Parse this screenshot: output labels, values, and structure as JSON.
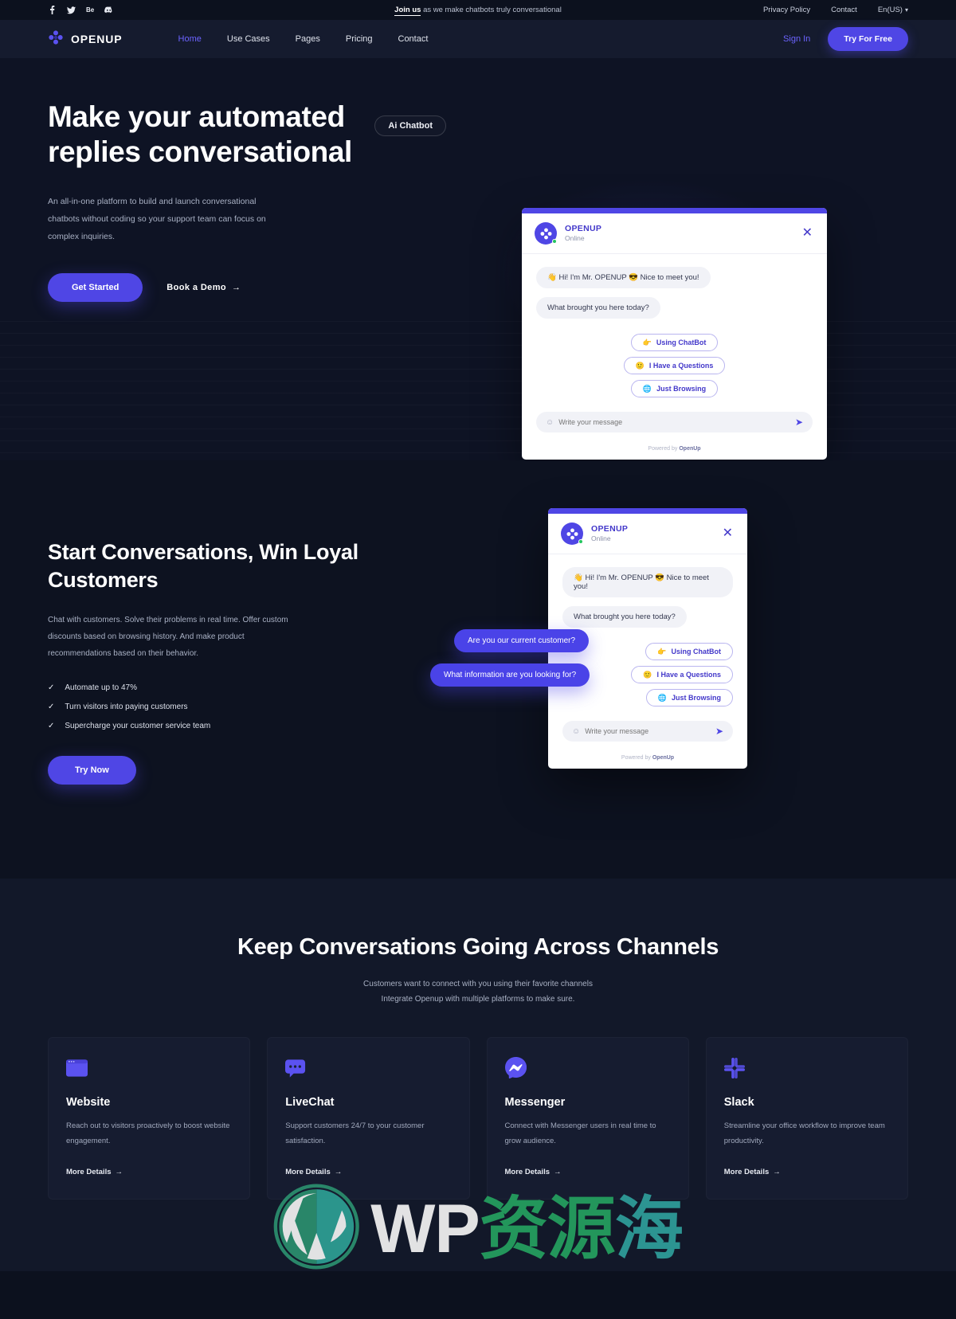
{
  "topbar": {
    "social": [
      {
        "name": "facebook-icon",
        "label": "f"
      },
      {
        "name": "twitter-icon",
        "label": "t"
      },
      {
        "name": "behance-icon",
        "label": "Be"
      },
      {
        "name": "discord-icon",
        "label": "d"
      }
    ],
    "announcement_link": "Join us",
    "announcement_rest": " as we make chatbots truly conversational",
    "privacy": "Privacy Policy",
    "contact": "Contact",
    "language": "En(US)"
  },
  "nav": {
    "brand": "OPENUP",
    "links": [
      {
        "label": "Home",
        "active": true
      },
      {
        "label": "Use Cases",
        "active": false
      },
      {
        "label": "Pages",
        "active": false
      },
      {
        "label": "Pricing",
        "active": false
      },
      {
        "label": "Contact",
        "active": false
      }
    ],
    "signin": "Sign In",
    "cta": "Try For Free"
  },
  "hero": {
    "title": "Make your automated replies conversational",
    "badge": "Ai Chatbot",
    "description": "An all-in-one platform to build and launch conversational chatbots without coding so your support team can focus on complex inquiries.",
    "primary_cta": "Get Started",
    "secondary_cta": "Book a  Demo",
    "secondary_arrow": "→"
  },
  "chat": {
    "name": "OPENUP",
    "status": "Online",
    "close": "✕",
    "messages": [
      "👋 Hi! I'm Mr. OPENUP 😎 Nice to meet you!",
      "What brought you here today?"
    ],
    "quick_replies": [
      {
        "icon": "👉",
        "label": "Using ChatBot"
      },
      {
        "icon": "🙂",
        "label": "I Have a Questions"
      },
      {
        "icon": "🌐",
        "label": "Just Browsing"
      }
    ],
    "input_placeholder": "Write your message",
    "emoji_icon": "☺",
    "send_icon": "➤",
    "powered_prefix": "Powered by ",
    "powered_brand": "OpenUp"
  },
  "section2": {
    "title": "Start Conversations, Win Loyal Customers",
    "description": "Chat with customers. Solve their problems in real time. Offer custom discounts based on browsing history. And make product recommendations based on their behavior.",
    "checklist": [
      "Automate up to 47%",
      "Turn visitors into paying customers",
      "Supercharge your customer service team"
    ],
    "cta": "Try Now",
    "float_bubbles": [
      "Are you our current customer?",
      "What information are you looking for?"
    ]
  },
  "section3": {
    "title": "Keep Conversations Going Across Channels",
    "subtitle_line1": "Customers want to connect with you using their favorite channels",
    "subtitle_line2": "Integrate Openup with multiple platforms to make sure.",
    "cards": [
      {
        "icon": "browser-window-icon",
        "title": "Website",
        "description": "Reach out to visitors proactively to boost website engagement.",
        "link": "More Details",
        "arrow": "→"
      },
      {
        "icon": "chat-bubble-icon",
        "title": "LiveChat",
        "description": "Support customers 24/7 to your customer satisfaction.",
        "link": "More Details",
        "arrow": "→"
      },
      {
        "icon": "messenger-icon",
        "title": "Messenger",
        "description": "Connect with Messenger users in real time to grow audience.",
        "link": "More Details",
        "arrow": "→"
      },
      {
        "icon": "slack-icon",
        "title": "Slack",
        "description": "Streamline your office workflow to improve team productivity.",
        "link": "More Details",
        "arrow": "→"
      }
    ]
  },
  "watermark": {
    "wp": "WP",
    "cn1": "资源",
    "cn2": "海"
  },
  "colors": {
    "accent": "#4f46e5",
    "accent_light": "#6c63ff",
    "bg_dark": "#0d1220",
    "bg_nav": "#151b2e",
    "bg_card": "#161c30",
    "online_green": "#22c55e"
  }
}
